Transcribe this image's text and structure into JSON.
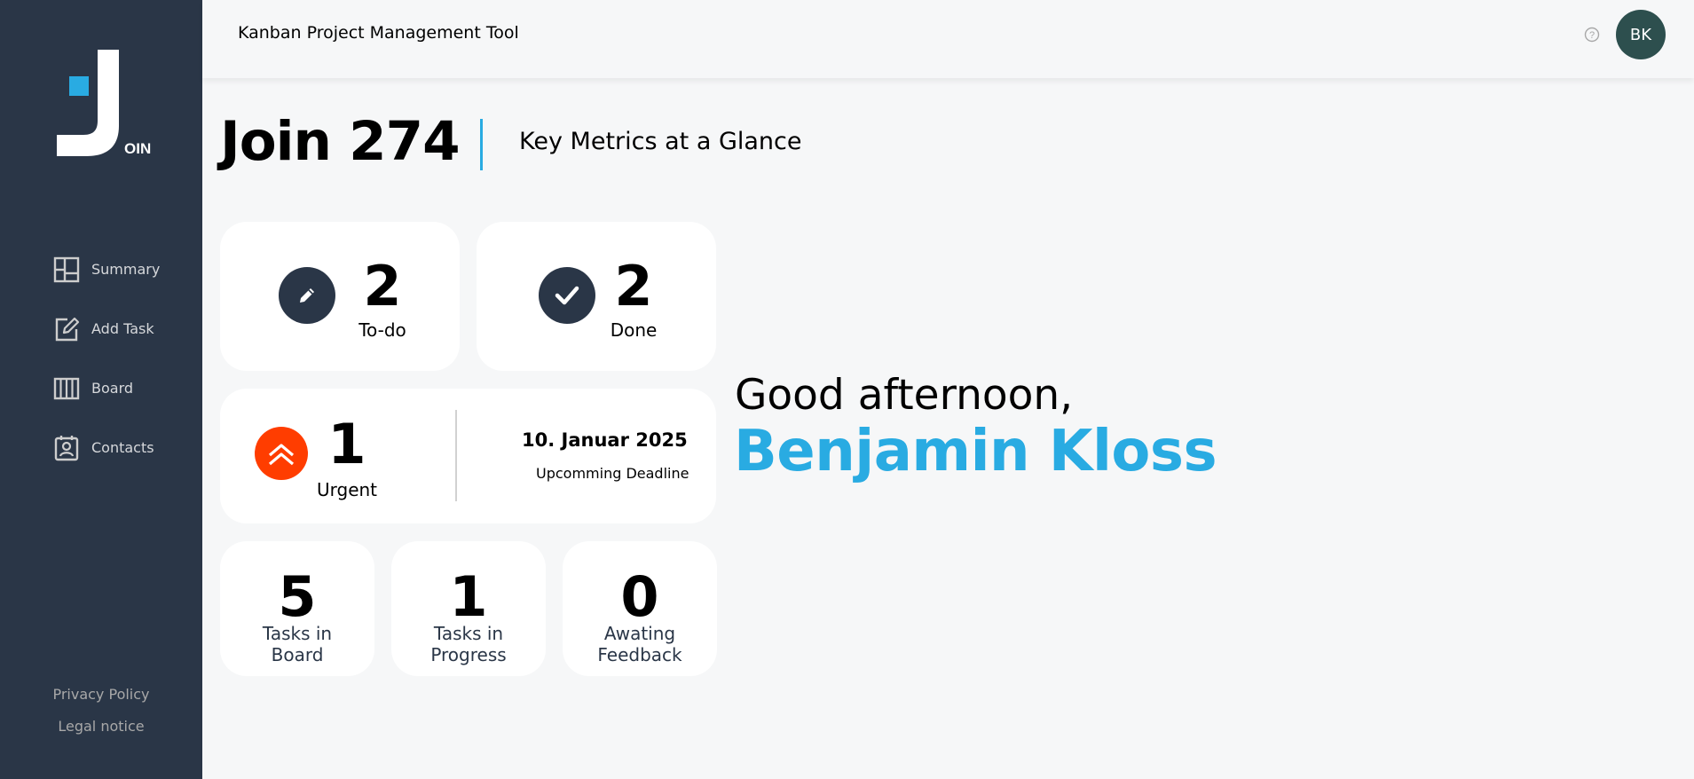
{
  "app": {
    "logo_letters": "OIN"
  },
  "sidebar": {
    "items": [
      {
        "label": "Summary",
        "icon": "summary-icon"
      },
      {
        "label": "Add Task",
        "icon": "add-task-icon"
      },
      {
        "label": "Board",
        "icon": "board-icon"
      },
      {
        "label": "Contacts",
        "icon": "contacts-icon"
      }
    ],
    "footer": {
      "privacy": "Privacy Policy",
      "legal": "Legal notice"
    }
  },
  "header": {
    "title": "Kanban Project Management Tool",
    "help_icon": "help-icon",
    "avatar_initials": "BK"
  },
  "page": {
    "title": "Join 274",
    "subtitle": "Key Metrics at a Glance"
  },
  "metrics": {
    "todo": {
      "count": "2",
      "label": "To-do",
      "icon": "pencil-icon"
    },
    "done": {
      "count": "2",
      "label": "Done",
      "icon": "check-icon"
    },
    "urgent": {
      "count": "1",
      "label": "Urgent",
      "icon": "urgent-chevrons-icon"
    },
    "deadline": {
      "date": "10. Januar 2025",
      "label": "Upcomming Deadline"
    },
    "tasks_in_board": {
      "count": "5",
      "label_line1": "Tasks in",
      "label_line2": "Board"
    },
    "tasks_in_progress": {
      "count": "1",
      "label_line1": "Tasks in",
      "label_line2": "Progress"
    },
    "awaiting_feedback": {
      "count": "0",
      "label_line1": "Awating",
      "label_line2": "Feedback"
    }
  },
  "greeting": {
    "text": "Good afternoon,",
    "name": "Benjamin Kloss"
  },
  "colors": {
    "sidebar_bg": "#2a3647",
    "accent": "#29abe2",
    "urgent": "#ff3d00",
    "avatar_bg": "#2d4f4e",
    "page_bg": "#f6f7f8"
  }
}
